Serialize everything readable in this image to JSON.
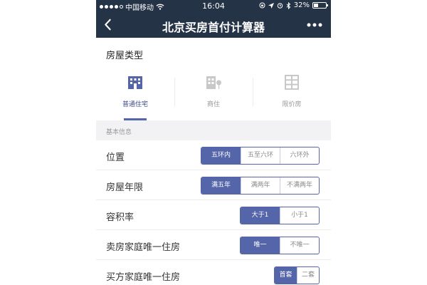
{
  "status_bar": {
    "carrier": "中国移动",
    "time": "16:04",
    "battery": "32%"
  },
  "nav": {
    "back_icon": "chevron-left",
    "title": "北京买房首付计算器",
    "more_icon": "more-dots"
  },
  "house_type": {
    "title": "房屋类型",
    "options": [
      {
        "label": "普通住宅",
        "icon": "apartment-building-icon",
        "selected": true
      },
      {
        "label": "商住",
        "icon": "building-tree-icon",
        "selected": false
      },
      {
        "label": "限价房",
        "icon": "grid-building-icon",
        "selected": false
      }
    ]
  },
  "section_header": "基本信息",
  "rows": [
    {
      "label": "位置",
      "options": [
        "五环内",
        "五至六环",
        "六环外"
      ],
      "selected": 0
    },
    {
      "label": "房屋年限",
      "options": [
        "满五年",
        "满两年",
        "不满两年"
      ],
      "selected": 0
    },
    {
      "label": "容积率",
      "options": [
        "大于1",
        "小于1"
      ],
      "selected": 0
    },
    {
      "label": "卖房家庭唯一住房",
      "options": [
        "唯一",
        "不唯一"
      ],
      "selected": 0
    },
    {
      "label": "买方家庭唯一住房",
      "options": [
        "首套",
        "二套"
      ],
      "selected": 0
    }
  ],
  "colors": {
    "header_bg": "#253347",
    "accent": "#5565a9"
  }
}
